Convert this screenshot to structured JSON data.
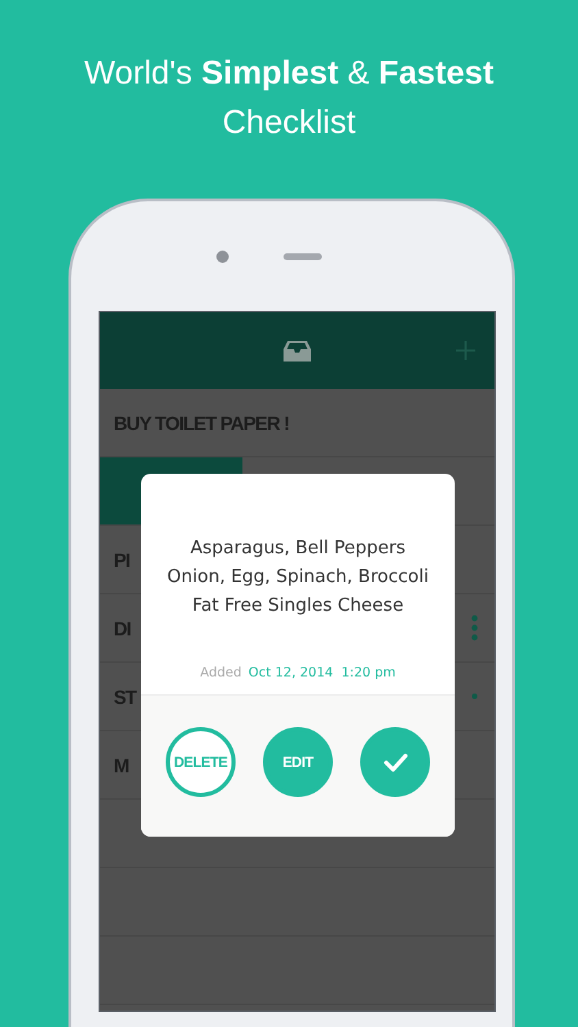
{
  "headline": {
    "line_1": "World's **Simplest** & **Fastest**",
    "line_2": "Checklist"
  },
  "list": [
    {
      "kind": "text",
      "text": "BUY TOILET PAPER !"
    },
    {
      "kind": "progress",
      "level": 0.36
    },
    {
      "kind": "text",
      "text": "PI"
    },
    {
      "kind": "text",
      "text": "DI",
      "has_menu": true
    },
    {
      "kind": "text",
      "text": "ST",
      "has_dot": true
    },
    {
      "kind": "text",
      "text": "M"
    },
    {
      "kind": "empty"
    },
    {
      "kind": "empty"
    },
    {
      "kind": "empty"
    }
  ],
  "dialog": {
    "lines": [
      "Asparagus, Bell Peppers",
      "Onion, Egg, Spinach, Broccoli",
      "Fat Free Singles Cheese"
    ],
    "added_label": "Added",
    "added_date": "Oct 12, 2014  1:20 pm",
    "buttons": [
      {
        "kind": "outline",
        "label": "DELETE"
      },
      {
        "kind": "filled",
        "label": "EDIT"
      },
      {
        "kind": "check"
      }
    ]
  }
}
